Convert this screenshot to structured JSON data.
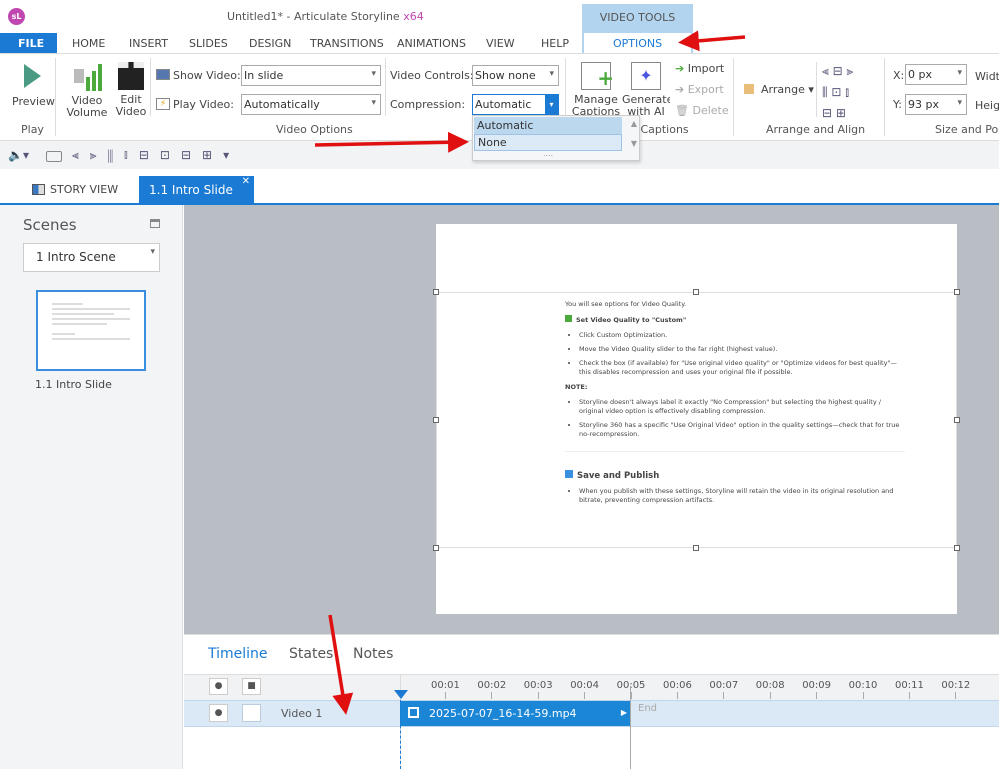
{
  "app": {
    "logo": "sL",
    "title": "Untitled1* -  Articulate Storyline",
    "arch": "x64"
  },
  "context_tab": {
    "group": "VIDEO TOOLS",
    "tab": "OPTIONS"
  },
  "menu": [
    "FILE",
    "HOME",
    "INSERT",
    "SLIDES",
    "DESIGN",
    "TRANSITIONS",
    "ANIMATIONS",
    "VIEW",
    "HELP"
  ],
  "ribbon": {
    "preview": "Preview",
    "play_group": "Play",
    "video_volume": "Video Volume",
    "edit_video": "Edit Video",
    "show_video_label": "Show Video:",
    "show_video_value": "In slide",
    "play_video_label": "Play Video:",
    "play_video_value": "Automatically",
    "video_controls_label": "Video Controls:",
    "video_controls_value": "Show none",
    "compression_label": "Compression:",
    "compression_value": "Automatic",
    "video_options_group": "Video Options",
    "manage_captions": "Manage Captions",
    "generate_ai": "Generate with AI",
    "import": "Import",
    "export": "Export",
    "delete": "Delete",
    "captions_group": "Closed Captions",
    "arrange": "Arrange",
    "arrange_group": "Arrange and Align",
    "x_label": "X:",
    "x_value": "0 px",
    "y_label": "Y:",
    "y_value": "93 px",
    "width_label": "Width",
    "height_label": "Height",
    "size_group": "Size and Position"
  },
  "compression_options": [
    "Automatic",
    "None"
  ],
  "view_tabs": {
    "story": "STORY VIEW",
    "slide": "1.1 Intro Slide"
  },
  "scenes": {
    "title": "Scenes",
    "selected": "1 Intro Scene",
    "slide_label": "1.1 Intro Slide"
  },
  "slide": {
    "intro": "You will see options for Video Quality.",
    "heading1": "Set Video Quality to \"Custom\"",
    "bullets1": [
      "Click Custom Optimization.",
      "Move the Video Quality slider to the far right (highest value).",
      "Check the box (if available) for \"Use original video quality\" or \"Optimize videos for best quality\"—this disables recompression and uses your original file if possible."
    ],
    "note": "NOTE:",
    "bullets2": [
      "Storyline doesn't always label it exactly \"No Compression\" but selecting the highest quality / original video option is effectively disabling compression.",
      "Storyline 360 has a specific \"Use Original Video\" option in the quality settings—check that for true no-recompression."
    ],
    "heading2": "Save and Publish",
    "bullets3": [
      "When you publish with these settings, Storyline will retain the video in its original resolution and bitrate, preventing compression artifacts."
    ]
  },
  "timeline": {
    "tabs": [
      "Timeline",
      "States",
      "Notes"
    ],
    "ticks": [
      "00:01",
      "00:02",
      "00:03",
      "00:04",
      "00:05",
      "00:06",
      "00:07",
      "00:08",
      "00:09",
      "00:10",
      "00:11",
      "00:12"
    ],
    "layer": "Video 1",
    "clip": "2025-07-07_16-14-59.mp4",
    "end": "End"
  },
  "colors": {
    "accent": "#1b7ad3",
    "context": "#b3d4ee",
    "arrow": "#e01010"
  }
}
